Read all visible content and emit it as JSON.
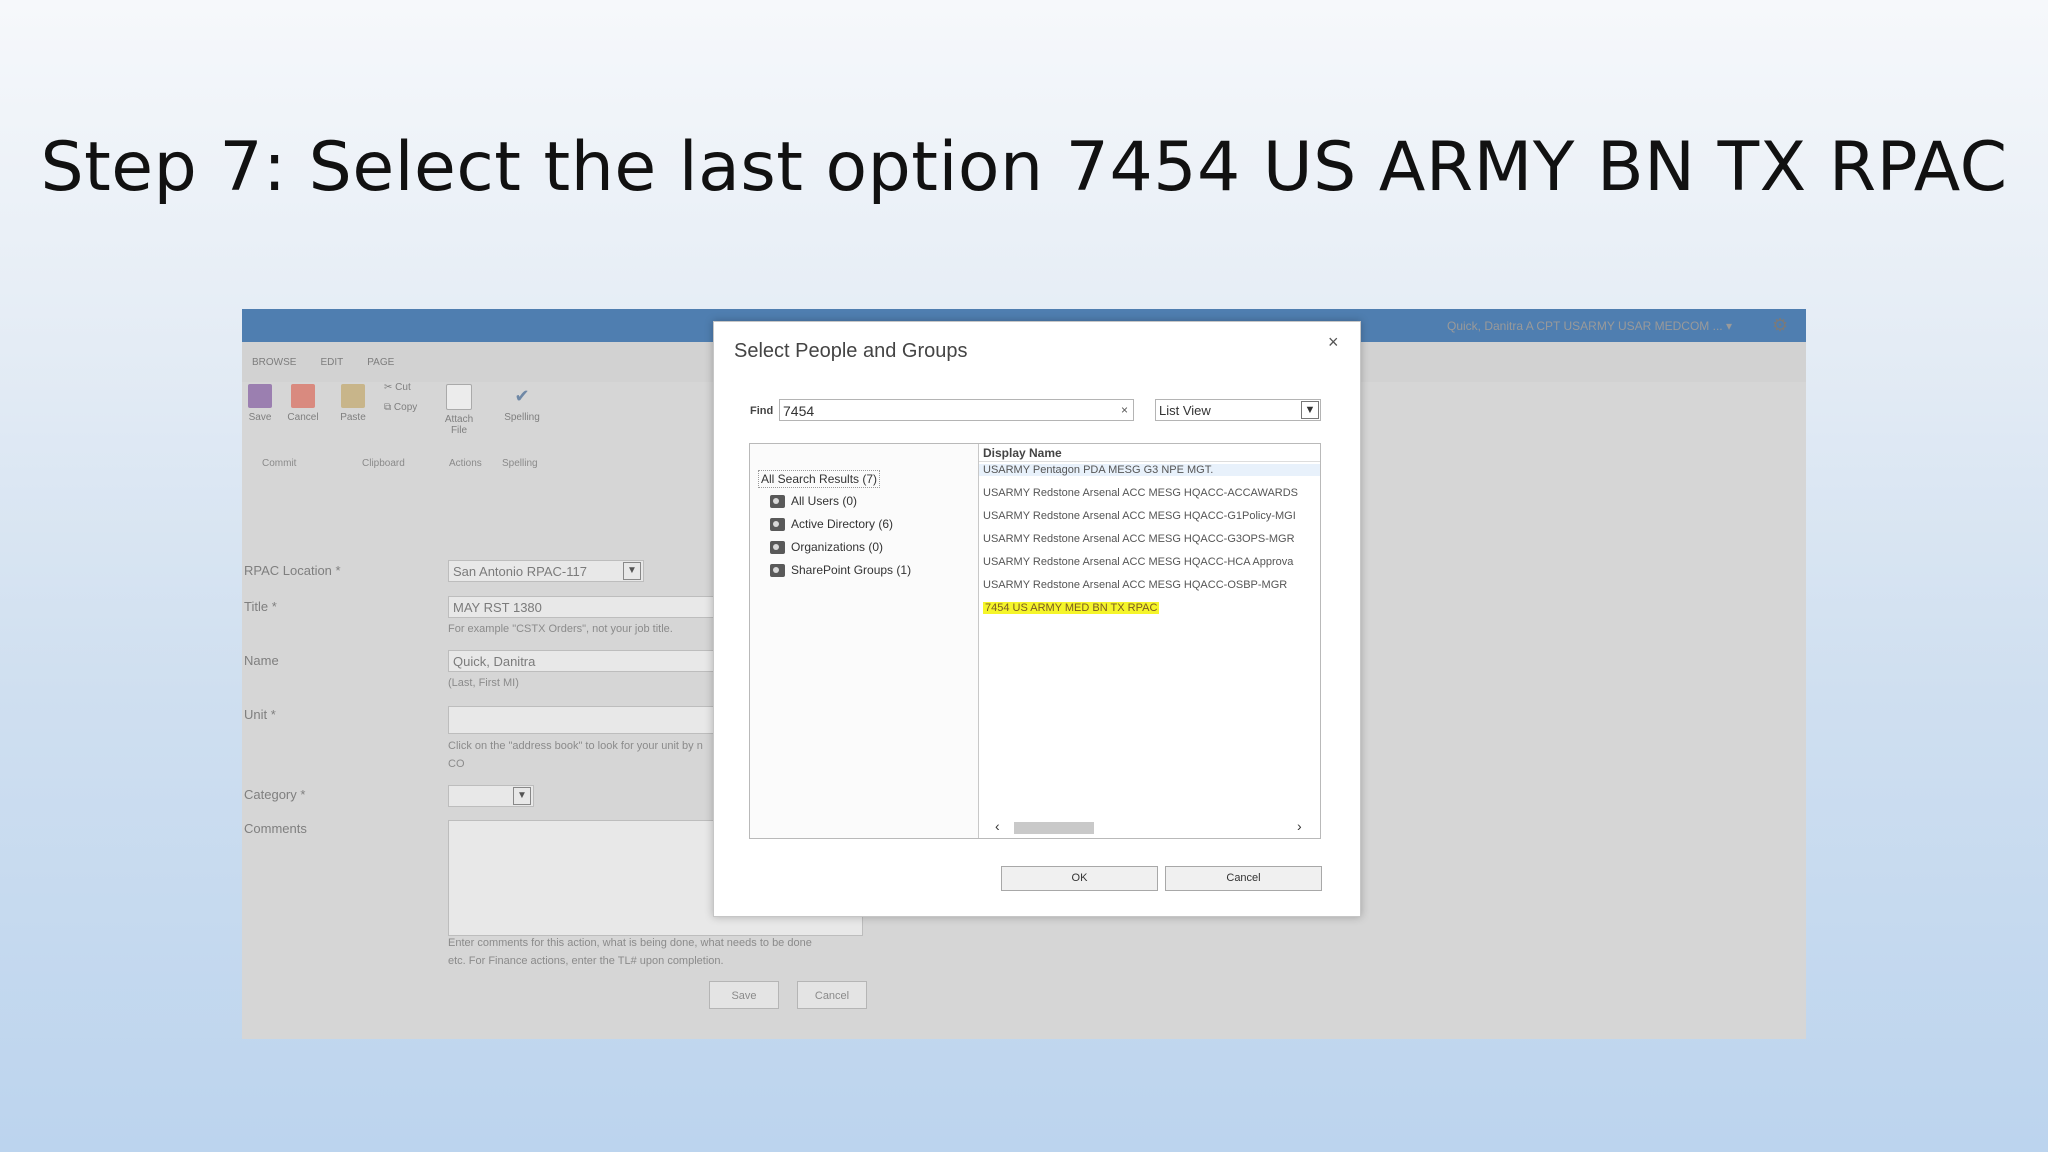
{
  "slide": {
    "title": "Step 7: Select the last option 7454 US ARMY BN TX RPAC"
  },
  "sharepoint": {
    "user": "Quick, Danitra A CPT USARMY USAR MEDCOM ... ▾",
    "tabs": [
      "BROWSE",
      "EDIT",
      "PAGE"
    ],
    "ribbon": {
      "save": "Save",
      "cancel": "Cancel",
      "paste": "Paste",
      "cut": "Cut",
      "copy": "Copy",
      "attach": "Attach File",
      "spelling": "Spelling",
      "groups": [
        "Commit",
        "Clipboard",
        "Actions",
        "Spelling"
      ]
    },
    "form": {
      "rpac_label": "RPAC Location *",
      "rpac_value": "San Antonio RPAC-117",
      "title_label": "Title *",
      "title_value": "MAY RST 1380",
      "title_hint": "For example \"CSTX Orders\", not your job title.",
      "name_label": "Name",
      "name_value": "Quick, Danitra",
      "name_hint": "(Last, First MI)",
      "unit_label": "Unit *",
      "unit_hint1": "Click on the \"address book\" to look for your unit by n",
      "unit_hint2": "CO",
      "category_label": "Category *",
      "comments_label": "Comments",
      "comments_hint1": "Enter comments for this action, what is being done, what needs to be done",
      "comments_hint2": "etc. For Finance actions, enter the TL# upon completion.",
      "save": "Save",
      "cancel": "Cancel"
    }
  },
  "dialog": {
    "title": "Select People and Groups",
    "close": "×",
    "find_label": "Find",
    "find_value": "7454",
    "clear": "×",
    "view": "List View",
    "tree": {
      "root": "All Search Results (7)",
      "items": [
        "All Users (0)",
        "Active Directory (6)",
        "Organizations (0)",
        "SharePoint Groups (1)"
      ]
    },
    "column": "Display Name",
    "results": [
      "USARMY Pentagon PDA MESG G3 NPE MGT.",
      "USARMY Redstone Arsenal ACC MESG HQACC-ACCAWARDS",
      "USARMY Redstone Arsenal ACC MESG HQACC-G1Policy-MGI",
      "USARMY Redstone Arsenal ACC MESG HQACC-G3OPS-MGR",
      "USARMY Redstone Arsenal ACC MESG HQACC-HCA Approva",
      "USARMY Redstone Arsenal ACC MESG HQACC-OSBP-MGR",
      "7454 US ARMY MED BN TX RPAC"
    ],
    "ok": "OK",
    "cancel": "Cancel"
  }
}
